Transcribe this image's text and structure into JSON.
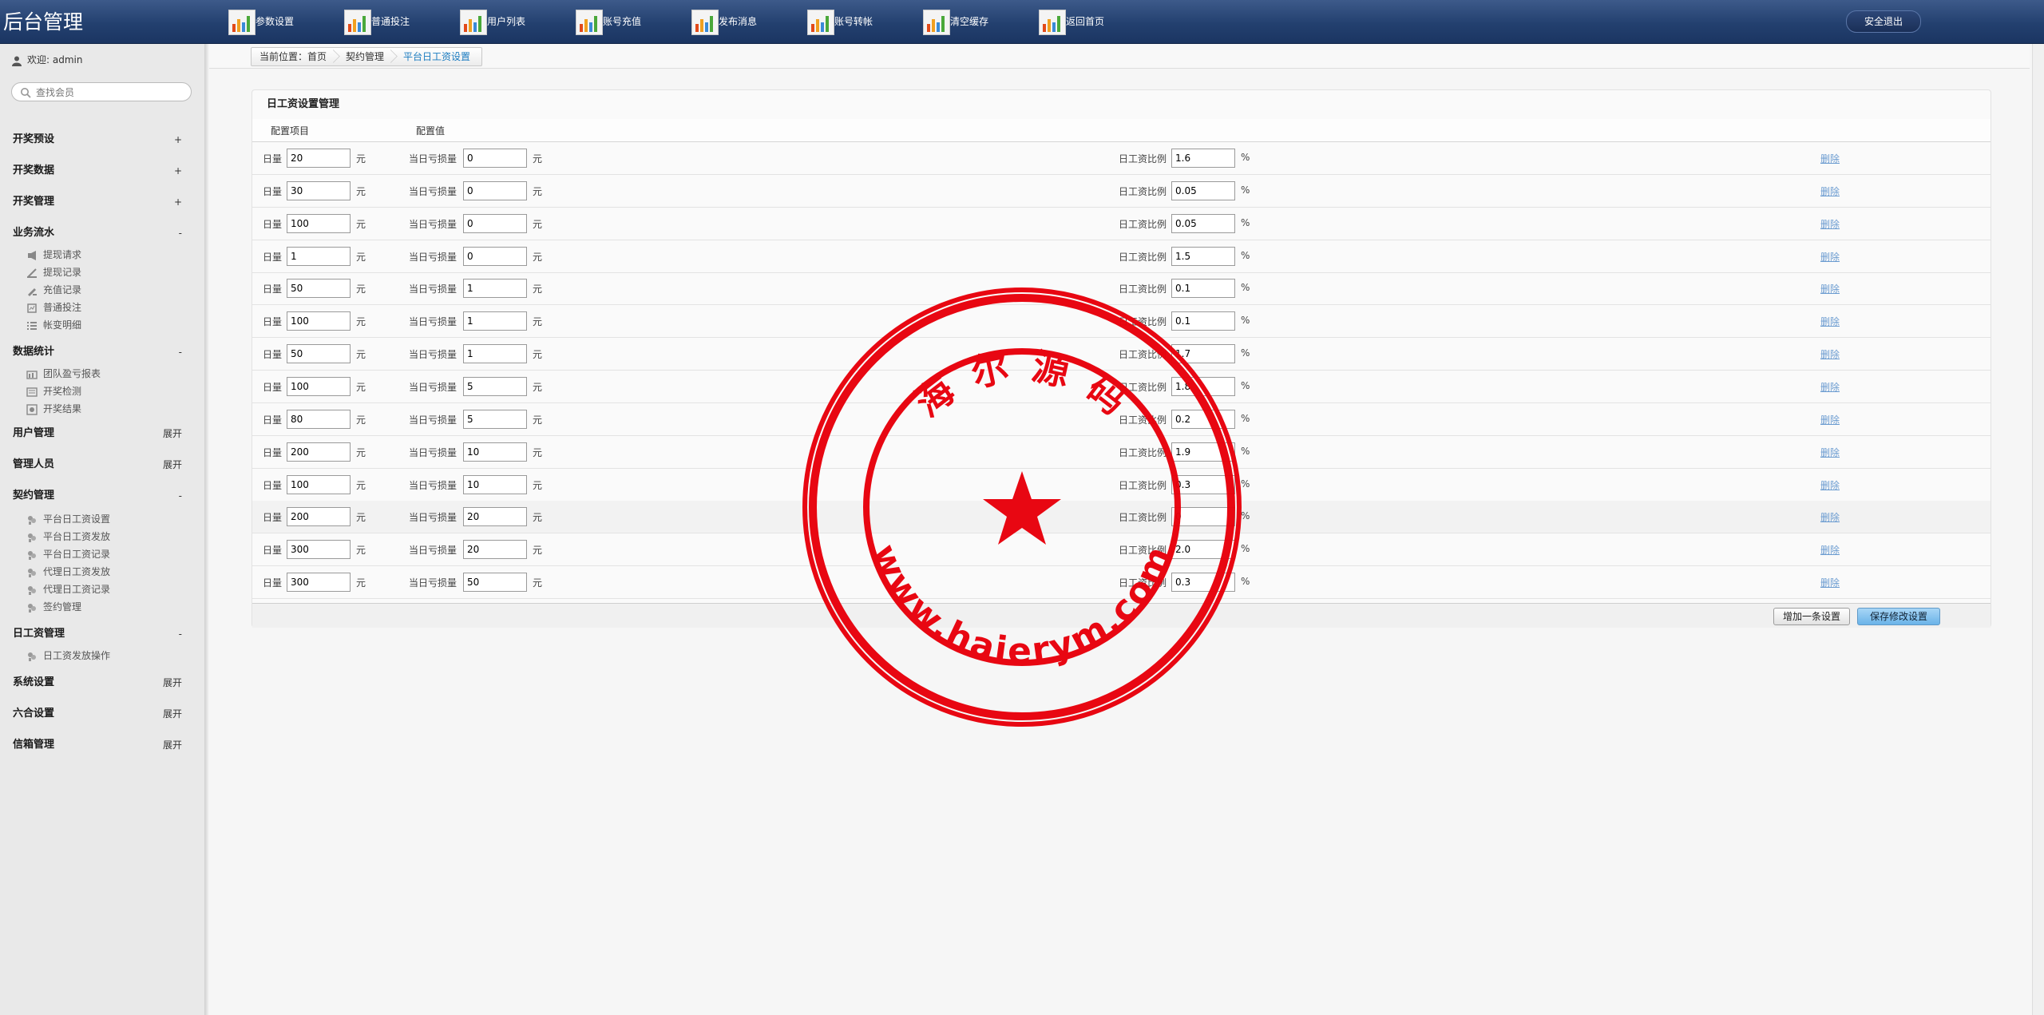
{
  "app": {
    "title": "后台管理"
  },
  "topnav": {
    "items": [
      {
        "label": "参数设置"
      },
      {
        "label": "普通投注"
      },
      {
        "label": "用户列表"
      },
      {
        "label": "账号充值"
      },
      {
        "label": "发布消息"
      },
      {
        "label": "账号转帐"
      },
      {
        "label": "清空缓存"
      },
      {
        "label": "返回首页"
      }
    ],
    "logout_label": "安全退出"
  },
  "sidebar": {
    "welcome": "欢迎: admin",
    "search_placeholder": "查找会员",
    "groups": [
      {
        "label": "开奖预设",
        "toggle": "+"
      },
      {
        "label": "开奖数据",
        "toggle": "+"
      },
      {
        "label": "开奖管理",
        "toggle": "+"
      },
      {
        "label": "业务流水",
        "toggle": "-",
        "items": [
          "提现请求",
          "提现记录",
          "充值记录",
          "普通投注",
          "帐变明细"
        ]
      },
      {
        "label": "数据统计",
        "toggle": "-",
        "items": [
          "团队盈亏报表",
          "开奖检测",
          "开奖结果"
        ]
      },
      {
        "label": "用户管理",
        "toggle": "展开"
      },
      {
        "label": "管理人员",
        "toggle": "展开"
      },
      {
        "label": "契约管理",
        "toggle": "-",
        "items": [
          "平台日工资设置",
          "平台日工资发放",
          "平台日工资记录",
          "代理日工资发放",
          "代理日工资记录",
          "签约管理"
        ]
      },
      {
        "label": "日工资管理",
        "toggle": "-",
        "items": [
          "日工资发放操作"
        ]
      },
      {
        "label": "系统设置",
        "toggle": "展开"
      },
      {
        "label": "六合设置",
        "toggle": "展开"
      },
      {
        "label": "信箱管理",
        "toggle": "展开"
      }
    ]
  },
  "breadcrumb": [
    "当前位置：首页",
    "契约管理",
    "平台日工资设置"
  ],
  "panel": {
    "title": "日工资设置管理",
    "col_item": "配置项目",
    "col_value": "配置值",
    "label_volume": "日量",
    "label_loss": "当日亏损量",
    "label_ratio": "日工资比例",
    "unit_yuan": "元",
    "unit_pct": "%",
    "delete_label": "删除",
    "rows": [
      {
        "volume": "20",
        "loss": "0",
        "ratio": "1.6"
      },
      {
        "volume": "30",
        "loss": "0",
        "ratio": "0.05"
      },
      {
        "volume": "100",
        "loss": "0",
        "ratio": "0.05"
      },
      {
        "volume": "1",
        "loss": "0",
        "ratio": "1.5"
      },
      {
        "volume": "50",
        "loss": "1",
        "ratio": "0.1"
      },
      {
        "volume": "100",
        "loss": "1",
        "ratio": "0.1"
      },
      {
        "volume": "50",
        "loss": "1",
        "ratio": "1.7"
      },
      {
        "volume": "100",
        "loss": "5",
        "ratio": "1.8"
      },
      {
        "volume": "80",
        "loss": "5",
        "ratio": "0.2"
      },
      {
        "volume": "200",
        "loss": "10",
        "ratio": "1.9"
      },
      {
        "volume": "100",
        "loss": "10",
        "ratio": "0.3"
      },
      {
        "volume": "200",
        "loss": "20",
        "ratio": "0"
      },
      {
        "volume": "300",
        "loss": "20",
        "ratio": "2.0"
      },
      {
        "volume": "300",
        "loss": "50",
        "ratio": "0.3"
      }
    ],
    "add_button": "增加一条设置",
    "save_button": "保存修改设置"
  },
  "watermark": {
    "top_text": "海 尔 源 码",
    "bottom_text": "www.haierym.com",
    "color": "#e8000b"
  }
}
